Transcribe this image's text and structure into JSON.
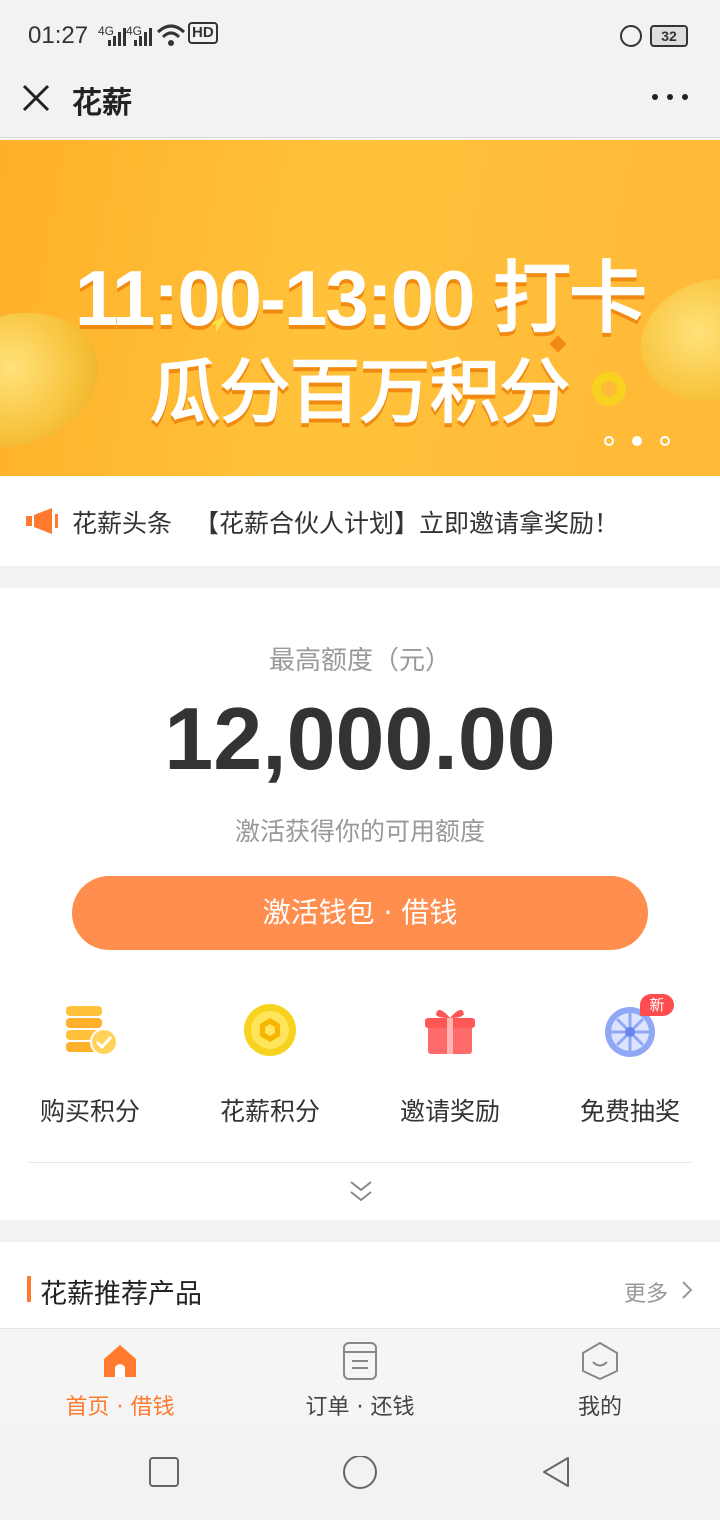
{
  "status_bar": {
    "time": "01:27",
    "signal1": "4G",
    "signal2": "4G",
    "hd": "HD",
    "battery": "32"
  },
  "header": {
    "title": "花薪"
  },
  "banner": {
    "line1": "11:00-13:00 打卡",
    "line2": "瓜分百万积分",
    "page_count": 3,
    "active_page": 2
  },
  "news": {
    "tag": "花薪头条",
    "text": "【花薪合伙人计划】立即邀请拿奖励！"
  },
  "quota": {
    "label": "最高额度（元）",
    "amount": "12,000.00",
    "subtitle": "激活获得你的可用额度",
    "button": "激活钱包 · 借钱"
  },
  "features": [
    {
      "label": "购买积分",
      "icon": "coins-check-icon"
    },
    {
      "label": "花薪积分",
      "icon": "points-coin-icon"
    },
    {
      "label": "邀请奖励",
      "icon": "gift-icon"
    },
    {
      "label": "免费抽奖",
      "icon": "lottery-wheel-icon",
      "badge": "新"
    }
  ],
  "recommend": {
    "title": "花薪推荐产品",
    "more": "更多"
  },
  "tabs": [
    {
      "label": "首页 · 借钱",
      "icon": "home-icon",
      "active": true
    },
    {
      "label": "订单 · 还钱",
      "icon": "order-icon",
      "active": false
    },
    {
      "label": "我的",
      "icon": "profile-icon",
      "active": false
    }
  ],
  "colors": {
    "accent": "#ff7a2e",
    "button": "#ff8e4f",
    "banner": "#ffb02a"
  }
}
